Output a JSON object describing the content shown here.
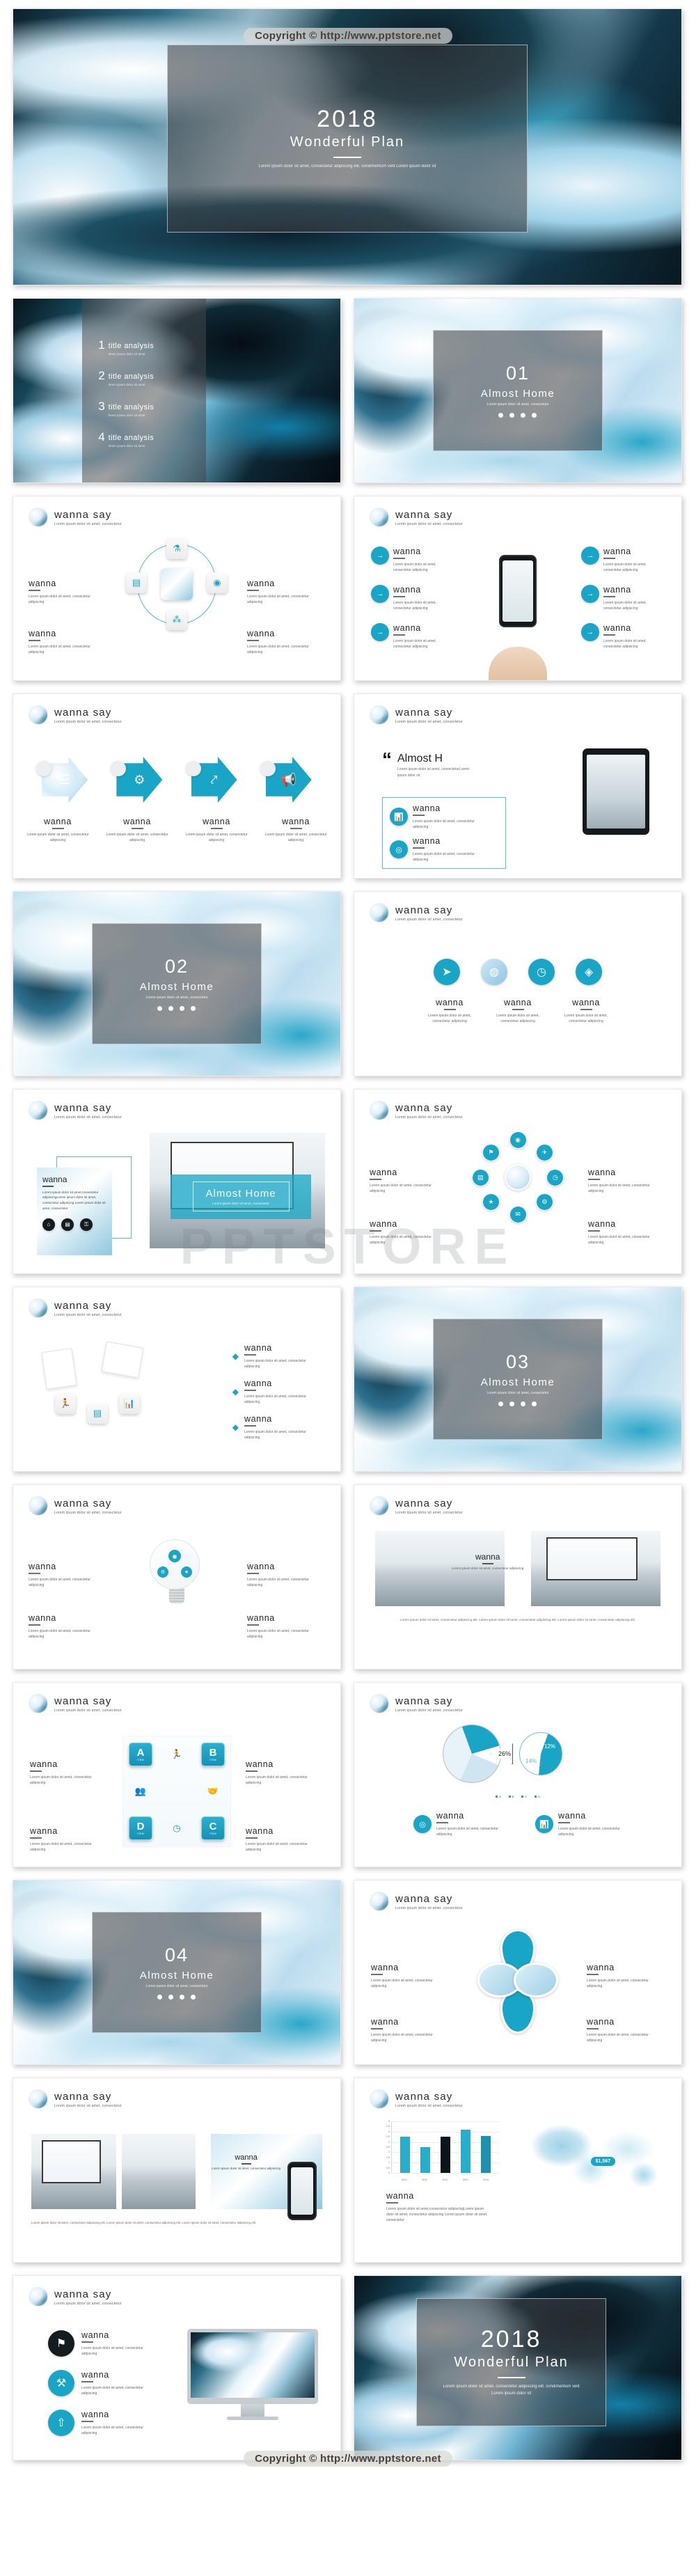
{
  "meta": {
    "watermark_text": "Copyright © http://www.pptstore.net",
    "ghost_watermark": "PPTSTORE",
    "accent_color": "#18a5c6",
    "dark_color": "#0b1a24",
    "overlay_color": "rgba(60,62,66,.58)"
  },
  "title_slide": {
    "year": "2018",
    "name": "Wonderful  Plan",
    "subtitle": "Lorem ipsum dolor sit amet, consectetur adipiscing elit.  condimentum velit Lorem ipsum dolor sit"
  },
  "agenda": {
    "items": [
      {
        "num": "1",
        "title": "title analysis",
        "desc": "lorem ipsum dolor sit amet"
      },
      {
        "num": "2",
        "title": "title analysis",
        "desc": "lorem ipsum dolor sit amet"
      },
      {
        "num": "3",
        "title": "title analysis",
        "desc": "lorem ipsum dolor sit amet"
      },
      {
        "num": "4",
        "title": "title analysis",
        "desc": "lorem ipsum dolor sit amet"
      }
    ]
  },
  "sections": [
    {
      "num": "01",
      "title": "Almost Home",
      "sub": "Lorem ipsum dolor sit amet, consectetur"
    },
    {
      "num": "02",
      "title": "Almost Home",
      "sub": "Lorem ipsum dolor sit amet, consectetur"
    },
    {
      "num": "03",
      "title": "Almost Home",
      "sub": "Lorem ipsum dolor sit amet, consectetur"
    },
    {
      "num": "04",
      "title": "Almost Home",
      "sub": "Lorem ipsum dolor sit amet, consectetur"
    }
  ],
  "common": {
    "header_title": "wanna  say",
    "header_sub": "Lorem ipsum dolor sit amet, consectetur",
    "block_title": "wanna",
    "block_text": "Lorem ipsum dolor sit amet, consectetur adipiscing",
    "quote_title": "Almost H",
    "quote_text": "Lorem ipsum dolor sit amet, consecteturLorem ipsum dolor sit",
    "banner_title": "Almost Home",
    "banner_sub": "Lorem ipsum dolor sit amet, consectetur",
    "long_text": "Lorem ipsum dolor sit amet,consectetur adipiscingLorem ipsum dolor sit amet, consectetur adipiscing Lorem ipsum dolor sit amet, consectetur",
    "footnote": "Lorem ipsum dolor sit amet, consectetur adipiscing elit. Lorem ipsum dolor sit amet, consectetur adipiscing elit. Lorem ipsum dolor sit amet, consectetur adipiscing elit."
  },
  "grid_slide": {
    "tiles": [
      {
        "letter": "A",
        "caption": "ITEM"
      },
      {
        "letter": "B",
        "caption": "ITEM"
      },
      {
        "letter": "C",
        "caption": "ITEM"
      },
      {
        "letter": "D",
        "caption": "ITEM"
      }
    ]
  },
  "chart_data": [
    {
      "type": "pie",
      "title": "wanna  say",
      "labels": [
        "A",
        "B",
        "C",
        "D"
      ],
      "values": [
        26,
        11,
        25,
        38
      ],
      "exploded_label": "26%",
      "sub_pie": {
        "values": [
          12,
          14
        ],
        "labels": [
          "12%",
          "14%"
        ]
      },
      "legend": [
        "A",
        "B",
        "C",
        "D"
      ],
      "legend_position": "bottom"
    },
    {
      "type": "bar",
      "title": "wanna  say",
      "categories": [
        "2010",
        "2011",
        "2012",
        "2013",
        "2014"
      ],
      "values": [
        3.5,
        2.5,
        3.5,
        4.2,
        3.6
      ],
      "bar_colors": [
        "#27aecd",
        "#27aecd",
        "#0b1418",
        "#27aecd",
        "#1b92b2"
      ],
      "yticks": [
        "5",
        "4.5",
        "4",
        "3.5",
        "3",
        "2.5",
        "2",
        "1.5",
        "1",
        "0.5",
        "0"
      ],
      "ylim": [
        0,
        5
      ],
      "xlabel": "",
      "ylabel": "",
      "grid": true
    }
  ],
  "map_slide": {
    "badge": "$1,567"
  },
  "final_slide": {
    "year": "2018",
    "name": "Wonderful  Plan",
    "subtitle": "Lorem ipsum dolor sit amet, consectetur adipiscing elit.  condimentum velit Lorem ipsum dolor sit"
  },
  "icons": {
    "flask": "⚗",
    "chat": "💬",
    "people": "👥",
    "network": "⁂",
    "gear": "⚙",
    "share": "⤤",
    "megaphone": "📢",
    "list": "☰",
    "chart": "📊",
    "clock": "🕐",
    "target": "◎",
    "rocket": "➤",
    "flag": "⚑",
    "tools": "⚒",
    "upload": "⇧",
    "home": "⌂",
    "briefcase": "▤",
    "lock": "⚿",
    "arrow-right": "→",
    "bulb": "💡",
    "diamond": "◆",
    "door": "▯",
    "runner": "🏃"
  }
}
